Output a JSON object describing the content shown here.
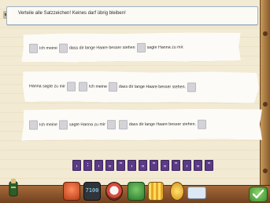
{
  "instruction": {
    "text": "Verteile alle Satzzeichen! Keines darf übrig bleiben!"
  },
  "cards": [
    {
      "segments": [
        "Ich meine",
        "dass dir lange Haare besser stehen",
        "sagte Hanna zu mir."
      ]
    },
    {
      "segments": [
        "Hanna sagte zu mir",
        "Ich meine",
        "dass dir lange Haare besser stehen."
      ]
    },
    {
      "segments": [
        "Ich meine",
        "sagte Hanna zu mir",
        "dass dir lange Haare besser stehen."
      ]
    }
  ],
  "punctuation_tokens": [
    ",",
    ":",
    ",",
    "„",
    "\"",
    ",",
    "„",
    "\"",
    "„",
    "\"",
    ",",
    "„",
    "\""
  ],
  "toolbar": {
    "counter_display": "7100"
  },
  "colors": {
    "token": "#5b3a86",
    "paper": "#f2ead2",
    "wood": "#8a5a2b",
    "check": "#3d8e2f"
  },
  "icons": [
    "book-icon",
    "stop-icon",
    "counter-display",
    "help-wheel-icon",
    "green-icon",
    "stripes-icon",
    "sun-icon",
    "speech-icon",
    "check-icon"
  ]
}
